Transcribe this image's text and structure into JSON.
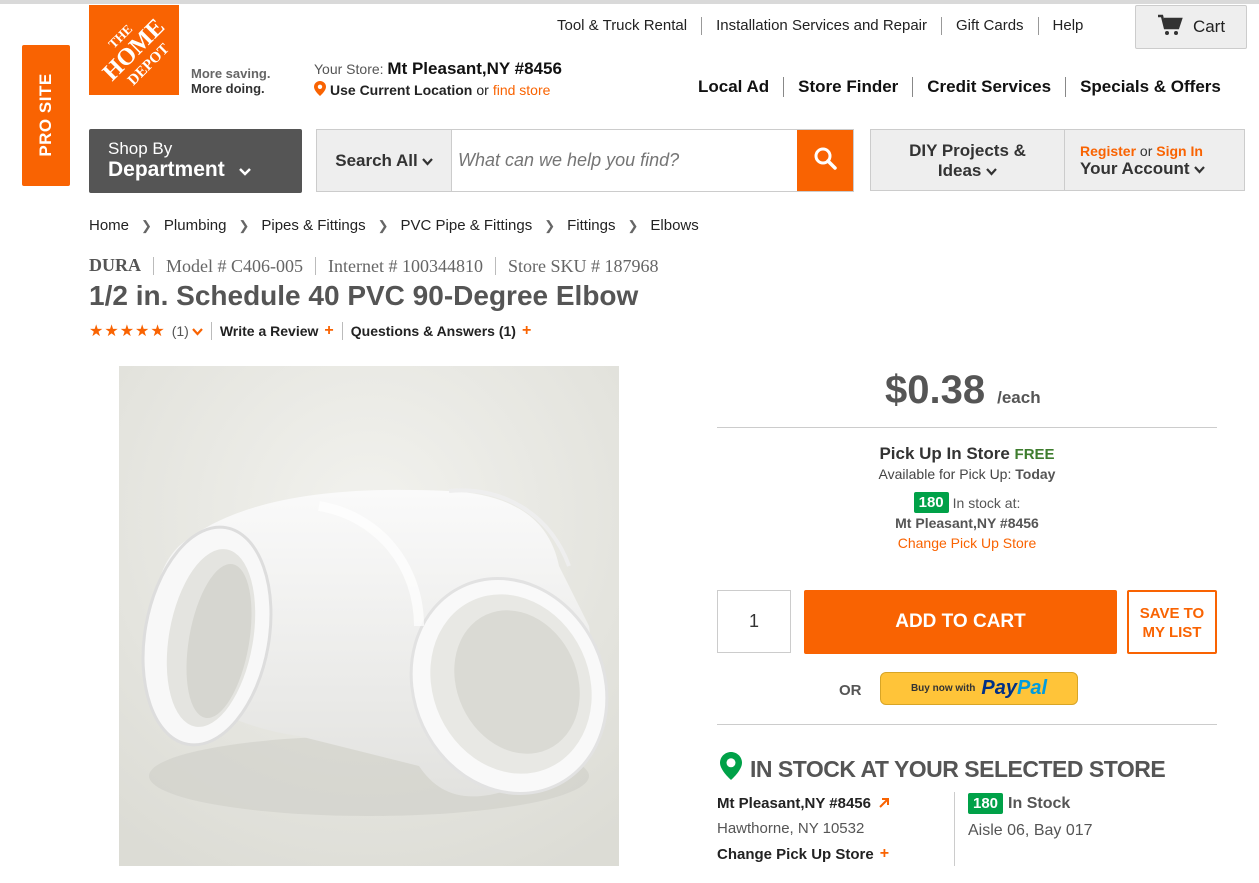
{
  "pro_tab": {
    "label": "PRO SITE"
  },
  "logo": {
    "line1": "THE",
    "line2": "HOME",
    "line3": "DEPOT"
  },
  "tagline": {
    "line1": "More saving.",
    "line2": "More doing."
  },
  "utility_nav": [
    "Tool & Truck Rental",
    "Installation Services and Repair",
    "Gift Cards",
    "Help"
  ],
  "cart": {
    "label": "Cart"
  },
  "store": {
    "label": "Your Store:",
    "name": "Mt Pleasant,NY #8456",
    "use_location": "Use Current Location",
    "or": "or",
    "find": "find store"
  },
  "main_nav": [
    "Local Ad",
    "Store Finder",
    "Credit Services",
    "Specials & Offers"
  ],
  "shop_dept": {
    "line1": "Shop By",
    "line2": "Department"
  },
  "search": {
    "scope": "Search All",
    "placeholder": "What can we help you find?"
  },
  "diy": {
    "line1": "DIY Projects &",
    "line2": "Ideas"
  },
  "account": {
    "register": "Register",
    "or": "or",
    "sign_in": "Sign In",
    "label": "Your Account"
  },
  "breadcrumb": [
    "Home",
    "Plumbing",
    "Pipes & Fittings",
    "PVC Pipe & Fittings",
    "Fittings",
    "Elbows"
  ],
  "product": {
    "brand": "DURA",
    "model": "Model # C406-005",
    "internet": "Internet # 100344810",
    "sku": "Store SKU # 187968",
    "title": "1/2 in. Schedule 40 PVC 90-Degree Elbow",
    "stars": "★★★★★",
    "review_count": "(1)",
    "write_review": "Write a Review",
    "qa": "Questions & Answers (1)"
  },
  "price": {
    "amount": "$0.38",
    "unit": "/each"
  },
  "pickup": {
    "title": "Pick Up In Store",
    "free": "FREE",
    "avail_label": "Available for Pick Up:",
    "avail_value": "Today",
    "count": "180",
    "in_stock_at": "In stock at:",
    "store": "Mt Pleasant,NY #8456",
    "change": "Change Pick Up Store"
  },
  "purchase": {
    "quantity": "1",
    "add_to_cart": "ADD TO CART",
    "save_line1": "SAVE TO",
    "save_line2": "MY LIST",
    "or": "OR",
    "paypal_buy": "Buy now with",
    "paypal_pay": "Pay",
    "paypal_pal": "Pal"
  },
  "instock": {
    "header": "IN STOCK AT YOUR SELECTED STORE",
    "store_name": "Mt Pleasant,NY #8456",
    "address": "Hawthorne, NY 10532",
    "change": "Change Pick Up Store",
    "count": "180",
    "status": "In Stock",
    "aisle": "Aisle 06, Bay 017"
  },
  "colors": {
    "brand": "#f96302",
    "stock_green": "#00a148"
  }
}
